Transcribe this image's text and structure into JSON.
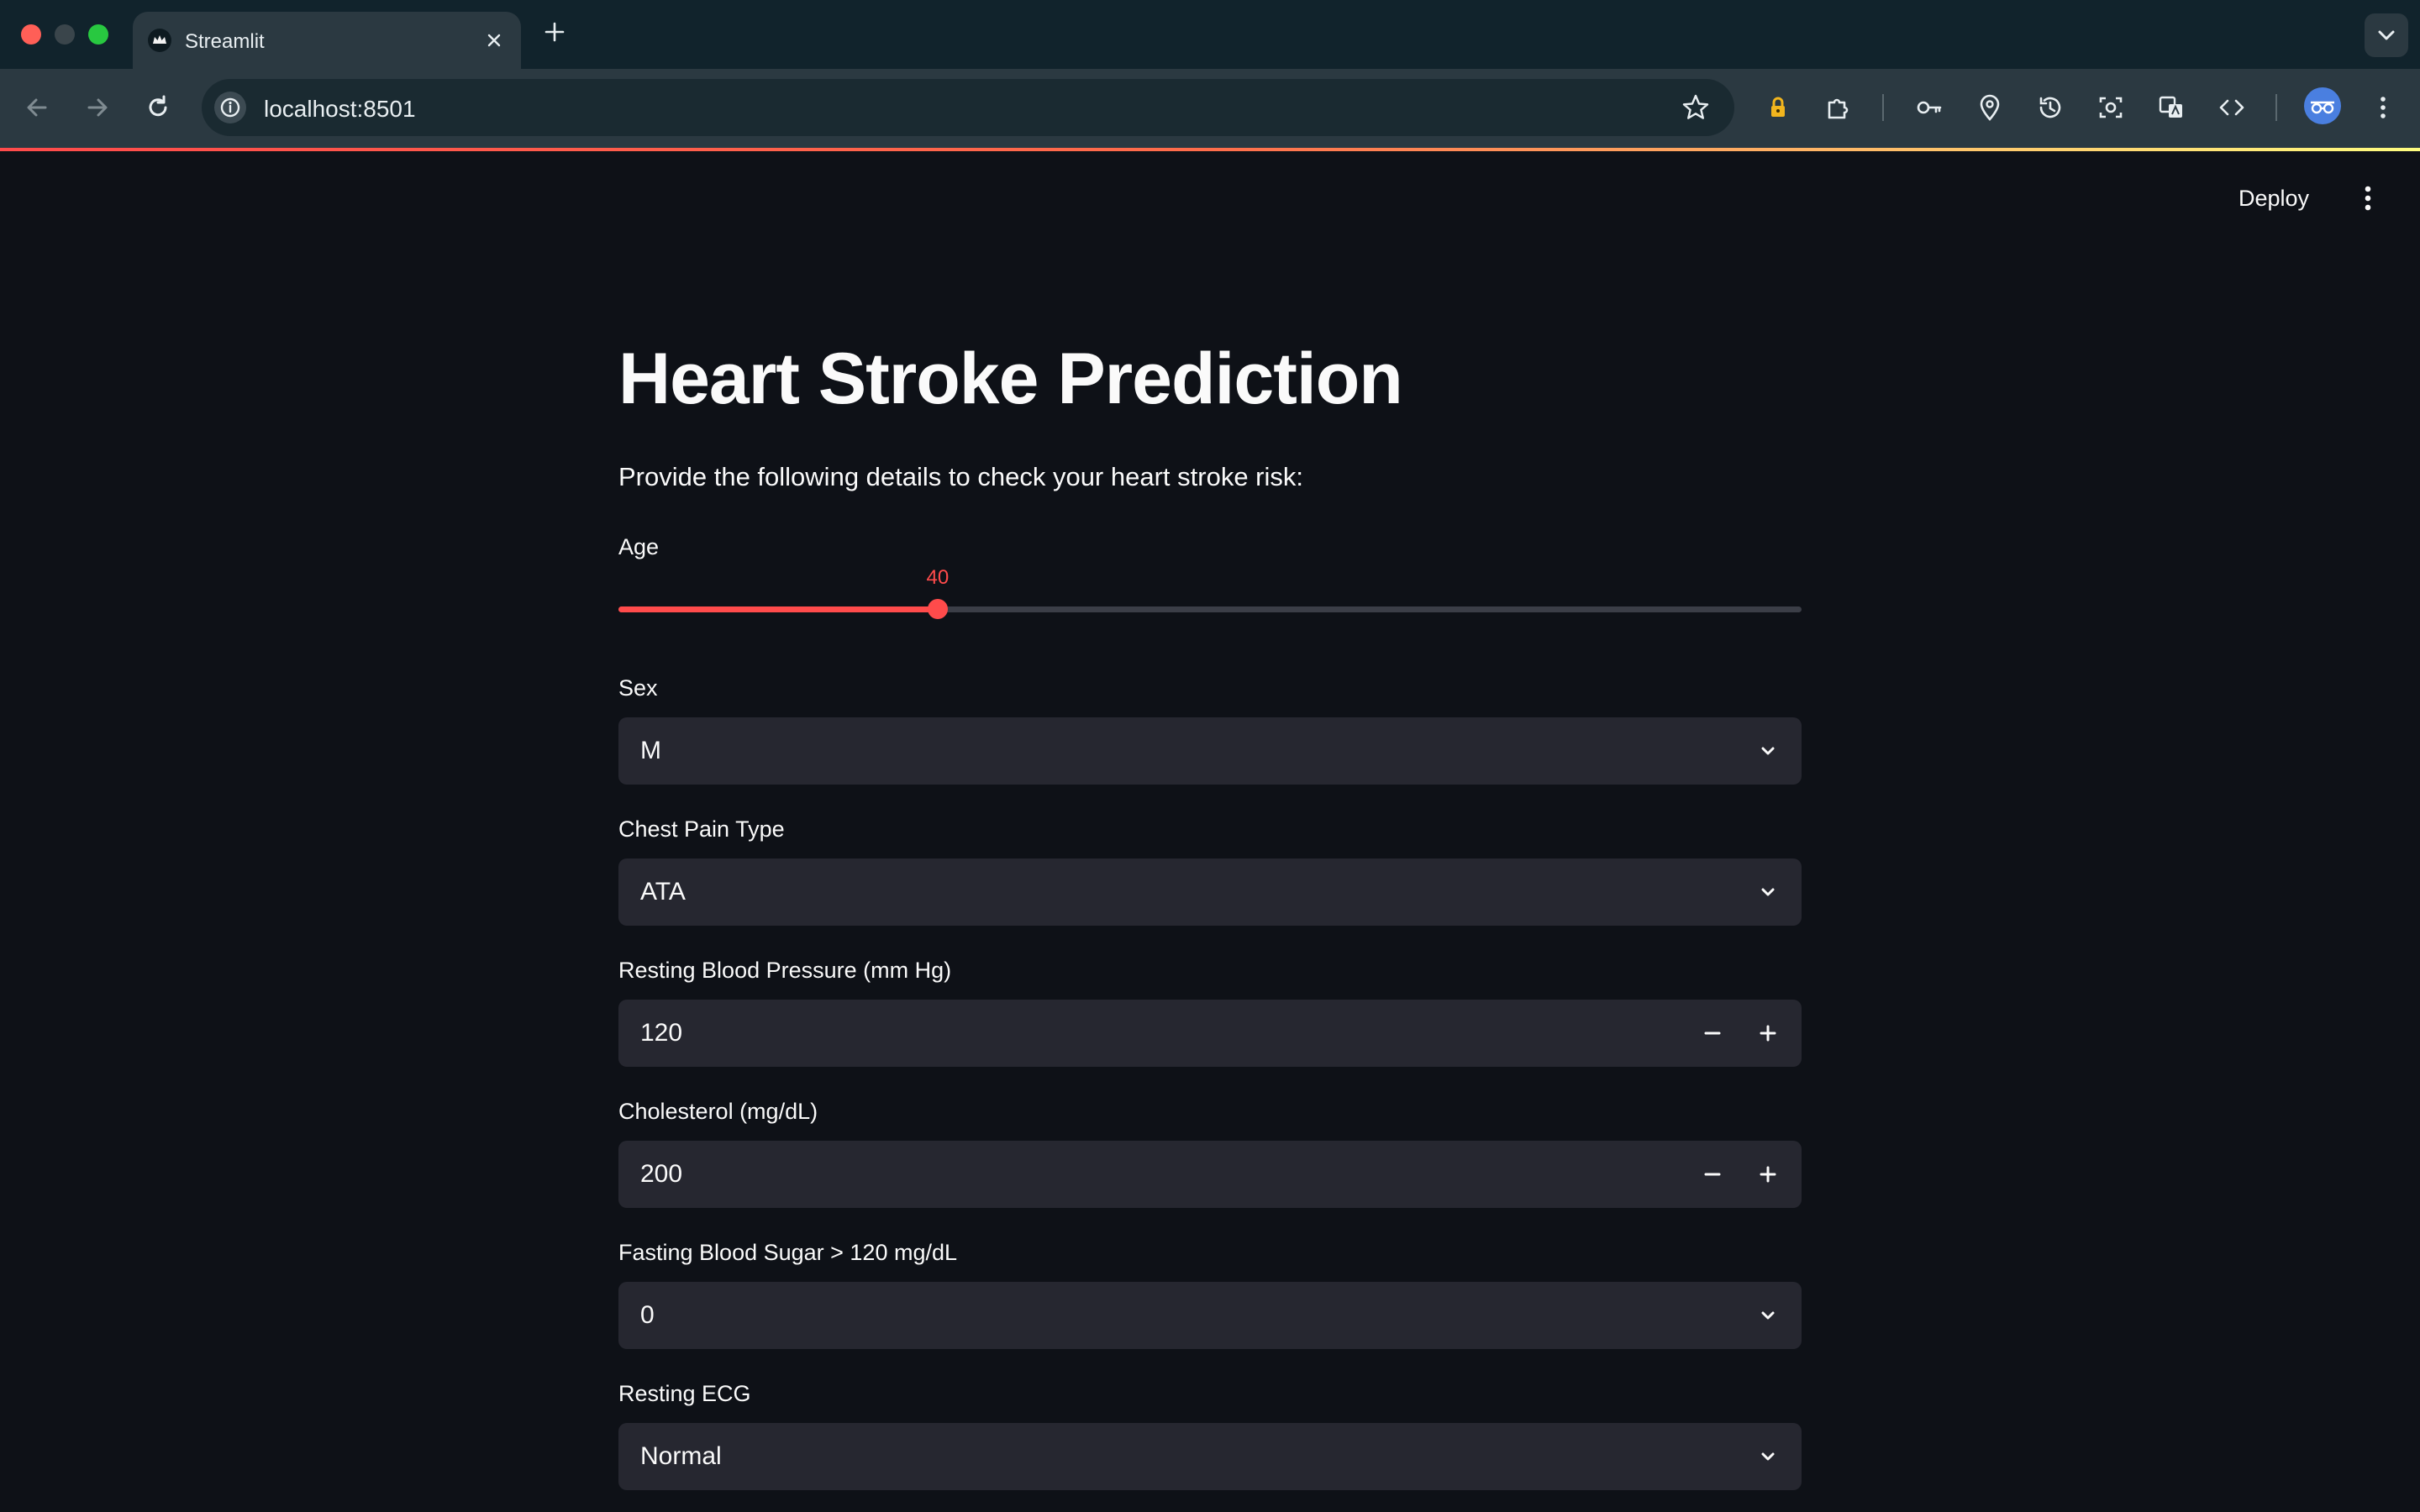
{
  "browser": {
    "tab_title": "Streamlit",
    "url": "localhost:8501"
  },
  "header": {
    "deploy_label": "Deploy"
  },
  "page": {
    "title": "Heart Stroke Prediction",
    "subtitle": "Provide the following details to check your heart stroke risk:"
  },
  "age": {
    "label": "Age",
    "value": "40",
    "fraction": 0.27
  },
  "sex": {
    "label": "Sex",
    "value": "M"
  },
  "chest_pain": {
    "label": "Chest Pain Type",
    "value": "ATA"
  },
  "resting_bp": {
    "label": "Resting Blood Pressure (mm Hg)",
    "value": "120"
  },
  "cholesterol": {
    "label": "Cholesterol (mg/dL)",
    "value": "200"
  },
  "fasting_bs": {
    "label": "Fasting Blood Sugar > 120 mg/dL",
    "value": "0"
  },
  "resting_ecg": {
    "label": "Resting ECG",
    "value": "Normal"
  },
  "colors": {
    "accent": "#ff4b4b",
    "background": "#0e1117",
    "input_bg": "#262730"
  }
}
